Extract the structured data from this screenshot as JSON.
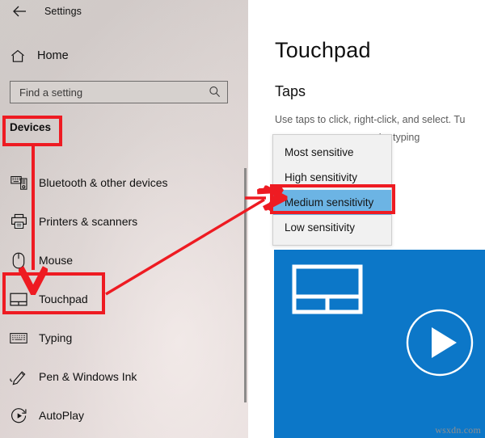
{
  "window": {
    "back_icon": "back-arrow-icon",
    "title": "Settings"
  },
  "sidebar": {
    "home": {
      "label": "Home",
      "icon": "home-icon"
    },
    "search": {
      "placeholder": "Find a setting",
      "value": "",
      "icon": "search-icon"
    },
    "category_header": "Devices",
    "items": [
      {
        "label": "Bluetooth & other devices",
        "icon": "bluetooth-devices-icon"
      },
      {
        "label": "Printers & scanners",
        "icon": "printer-icon"
      },
      {
        "label": "Mouse",
        "icon": "mouse-icon"
      },
      {
        "label": "Touchpad",
        "icon": "touchpad-icon"
      },
      {
        "label": "Typing",
        "icon": "keyboard-icon"
      },
      {
        "label": "Pen & Windows Ink",
        "icon": "pen-icon"
      },
      {
        "label": "AutoPlay",
        "icon": "autoplay-icon"
      }
    ]
  },
  "content": {
    "page_title": "Touchpad",
    "section_title": "Taps",
    "description": "Use taps to click, right-click, and select. Tu",
    "description_overflow": "'re typing",
    "dropdown": {
      "options": [
        "Most sensitive",
        "High sensitivity",
        "Medium sensitivity",
        "Low sensitivity"
      ],
      "selected": "Medium sensitivity",
      "selected_index": 2
    },
    "video": {
      "thumbnail_icon": "touchpad-outline-icon",
      "play_icon": "play-button-icon",
      "background_color": "#0c77c8"
    },
    "watermark": "wsxdn.com"
  },
  "annotations": {
    "highlight_color": "#ee1b22",
    "boxes": [
      {
        "name": "devices-header-highlight",
        "target": "Devices"
      },
      {
        "name": "touchpad-item-highlight",
        "target": "Touchpad"
      },
      {
        "name": "medium-sensitivity-highlight",
        "target": "Medium sensitivity"
      }
    ],
    "arrows": [
      {
        "name": "devices-to-touchpad-arrow",
        "from": "Devices",
        "to": "Touchpad"
      },
      {
        "name": "touchpad-to-medium-arrow",
        "from": "Touchpad",
        "to": "Medium sensitivity"
      },
      {
        "name": "pointer-to-medium-arrow",
        "from": "left",
        "to": "Medium sensitivity"
      }
    ]
  }
}
